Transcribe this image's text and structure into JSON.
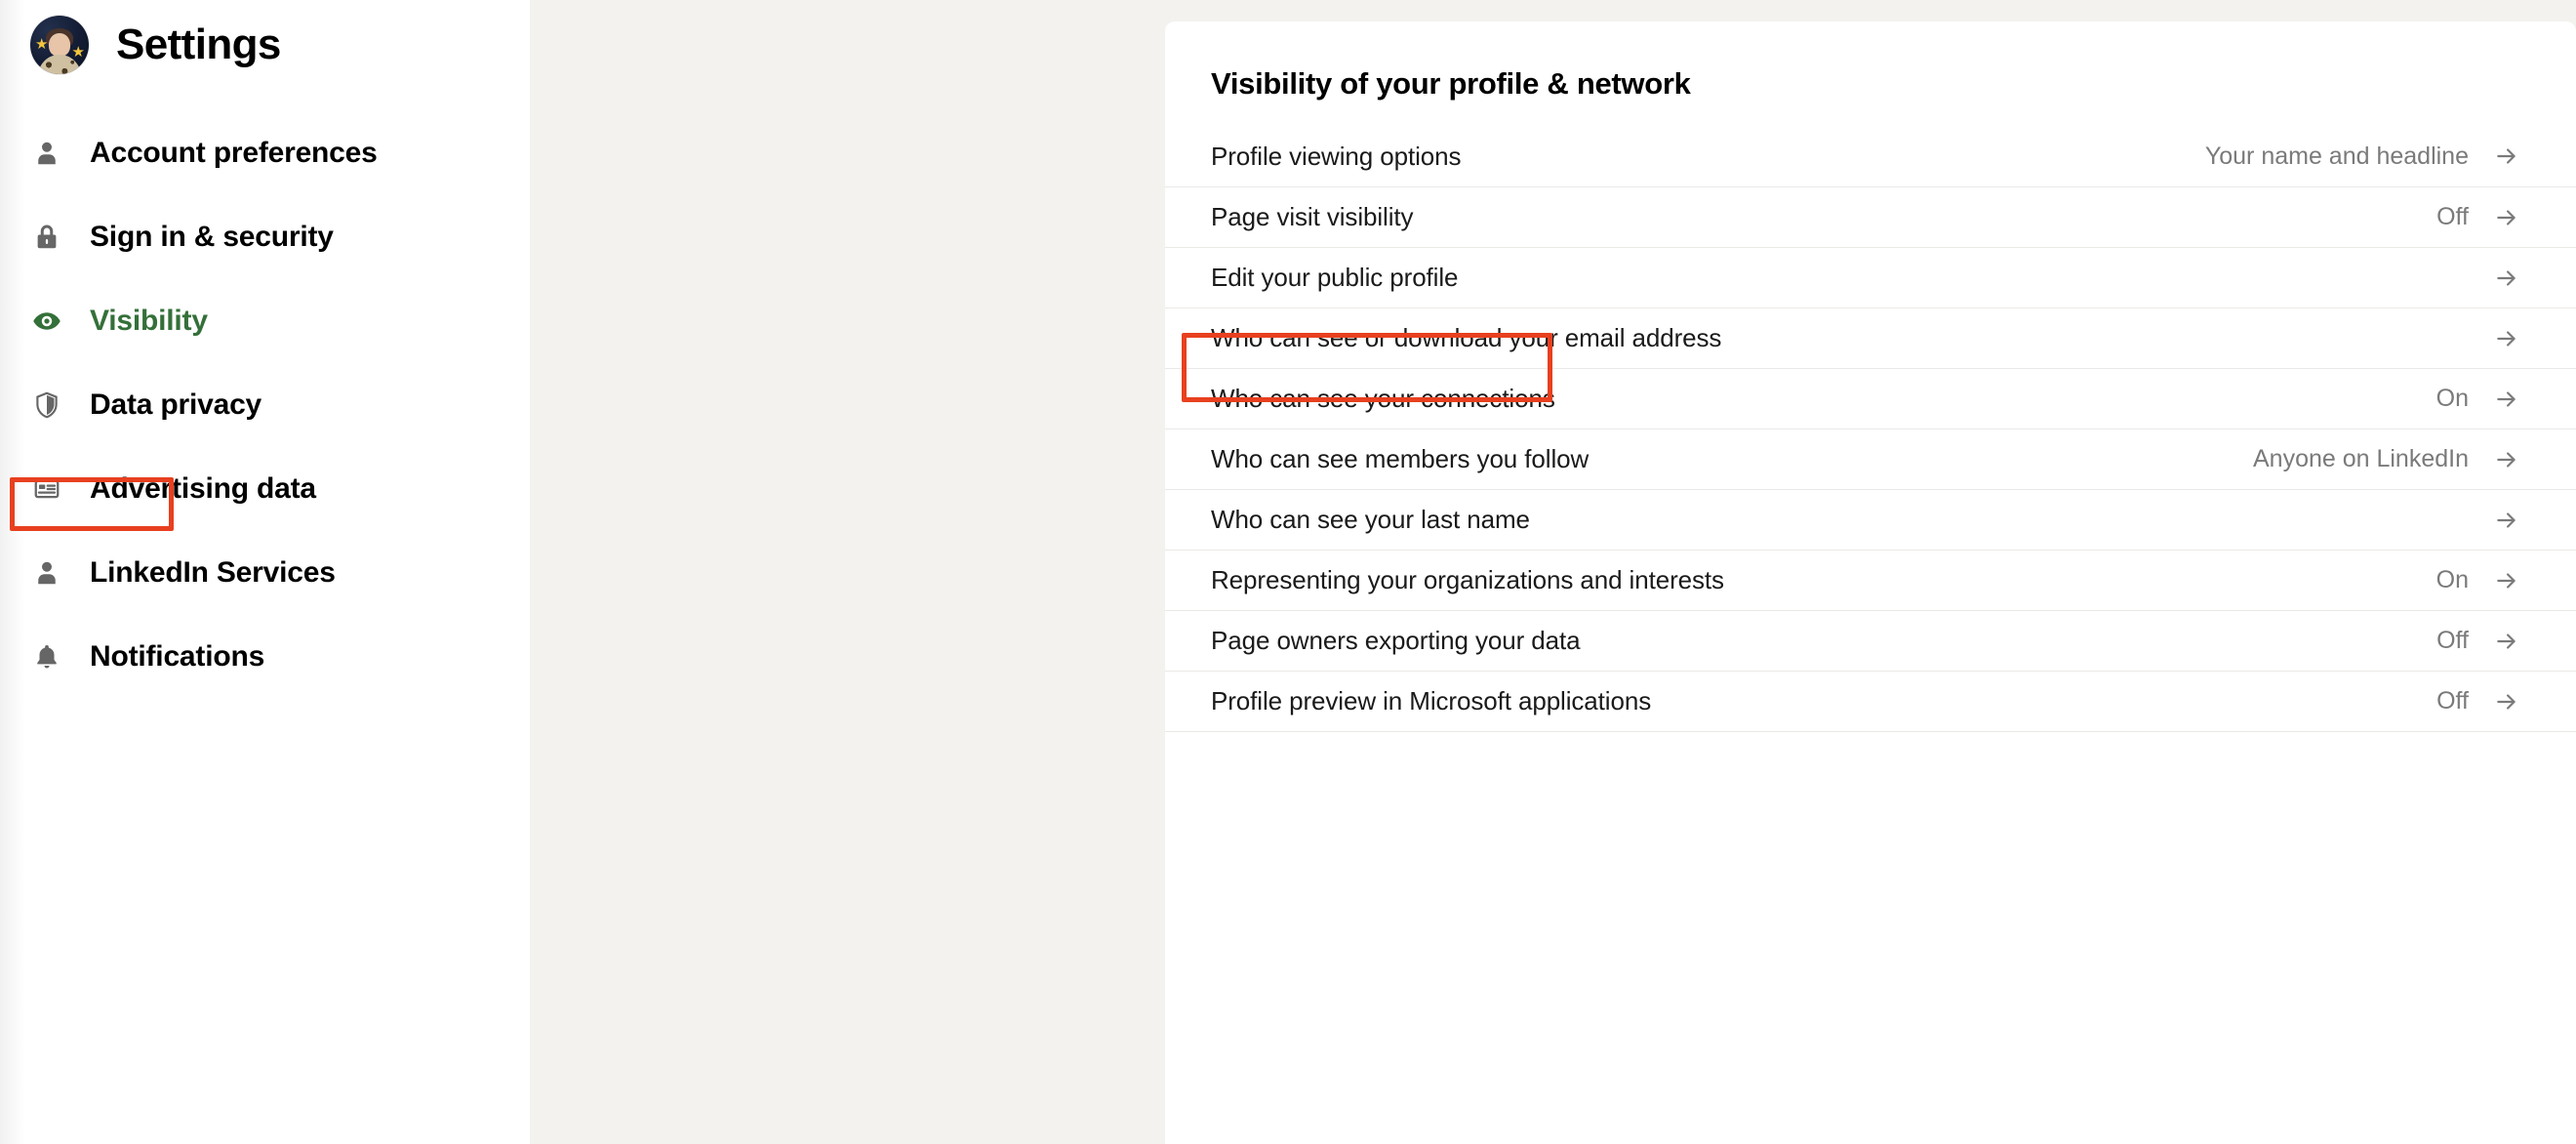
{
  "sidebar": {
    "title": "Settings",
    "avatar_name": "user-avatar",
    "items": [
      {
        "label": "Account preferences",
        "icon": "person-icon",
        "active": false
      },
      {
        "label": "Sign in & security",
        "icon": "lock-icon",
        "active": false
      },
      {
        "label": "Visibility",
        "icon": "eye-icon",
        "active": true
      },
      {
        "label": "Data privacy",
        "icon": "shield-icon",
        "active": false
      },
      {
        "label": "Advertising data",
        "icon": "card-icon",
        "active": false
      },
      {
        "label": "LinkedIn Services",
        "icon": "person-icon",
        "active": false
      },
      {
        "label": "Notifications",
        "icon": "bell-icon",
        "active": false
      }
    ]
  },
  "main": {
    "title": "Visibility of your profile & network",
    "rows": [
      {
        "label": "Profile viewing options",
        "value": "Your name and headline",
        "arrow": "arrow-right-icon"
      },
      {
        "label": "Page visit visibility",
        "value": "Off",
        "arrow": "arrow-right-icon"
      },
      {
        "label": "Edit your public profile",
        "value": "",
        "arrow": "arrow-right-icon"
      },
      {
        "label": "Who can see or download your email address",
        "value": "",
        "arrow": "arrow-right-icon"
      },
      {
        "label": "Who can see your connections",
        "value": "On",
        "arrow": "arrow-right-icon"
      },
      {
        "label": "Who can see members you follow",
        "value": "Anyone on LinkedIn",
        "arrow": "arrow-right-icon"
      },
      {
        "label": "Who can see your last name",
        "value": "",
        "arrow": "arrow-right-icon"
      },
      {
        "label": "Representing your organizations and interests",
        "value": "On",
        "arrow": "arrow-right-icon"
      },
      {
        "label": "Page owners exporting your data",
        "value": "Off",
        "arrow": "arrow-right-icon"
      },
      {
        "label": "Profile preview in Microsoft applications",
        "value": "Off",
        "arrow": "arrow-right-icon"
      }
    ]
  },
  "annotations": {
    "color": "#E8401F",
    "targets": [
      "Visibility",
      "Edit your public profile"
    ]
  },
  "colors": {
    "page_background": "#F4F2EE",
    "card_background": "#FFFFFF",
    "active_nav": "#347039",
    "muted_text": "#7A7A7A",
    "divider": "#EBE9E6"
  }
}
